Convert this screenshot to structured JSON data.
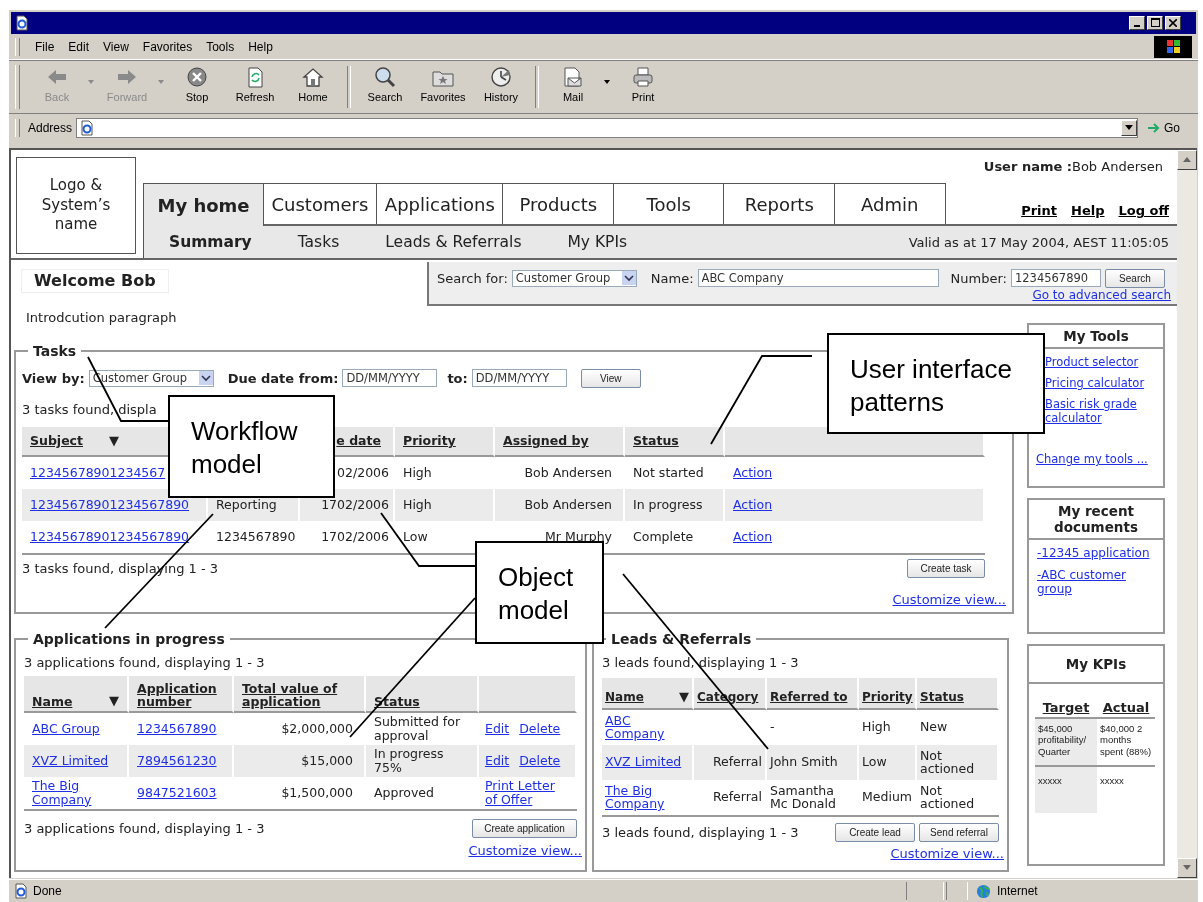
{
  "menu": [
    "File",
    "Edit",
    "View",
    "Favorites",
    "Tools",
    "Help"
  ],
  "toolbar": [
    {
      "kind": "back",
      "label": "Back",
      "disabled": true,
      "has_menu": true
    },
    {
      "kind": "forward",
      "label": "Forward",
      "disabled": true,
      "has_menu": true
    },
    {
      "kind": "stop",
      "label": "Stop",
      "disabled": false,
      "has_menu": false
    },
    {
      "kind": "refresh",
      "label": "Refresh",
      "disabled": false,
      "has_menu": false
    },
    {
      "kind": "home",
      "label": "Home",
      "disabled": false,
      "has_menu": false
    },
    {
      "kind": "separator"
    },
    {
      "kind": "search",
      "label": "Search",
      "disabled": false,
      "has_menu": false
    },
    {
      "kind": "favorites",
      "label": "Favorites",
      "disabled": false,
      "has_menu": false
    },
    {
      "kind": "history",
      "label": "History",
      "disabled": false,
      "has_menu": false
    },
    {
      "kind": "separator"
    },
    {
      "kind": "mail",
      "label": "Mail",
      "disabled": false,
      "has_menu": true
    },
    {
      "kind": "print",
      "label": "Print",
      "disabled": false,
      "has_menu": false
    }
  ],
  "address": {
    "label": "Address",
    "go": "Go"
  },
  "logo": "Logo & System’s name",
  "user_name": "**User name :**Bob Andersen",
  "header_links": [
    "Print",
    "Help",
    "Log off"
  ],
  "tabs": [
    {
      "label": "My home",
      "selected": true
    },
    {
      "label": "Customers",
      "selected": false
    },
    {
      "label": "Applications",
      "selected": false
    },
    {
      "label": "Products",
      "selected": false
    },
    {
      "label": "Tools",
      "selected": false
    },
    {
      "label": "Reports",
      "selected": false
    },
    {
      "label": "Admin",
      "selected": false
    }
  ],
  "subtabs": [
    {
      "label": "Summary",
      "selected": true
    },
    {
      "label": "Tasks",
      "selected": false
    },
    {
      "label": "Leads & Referrals",
      "selected": false
    },
    {
      "label": "My KPIs",
      "selected": false
    }
  ],
  "valid_as_at": "Valid as at 17 May 2004, AEST 11:05:05",
  "welcome": "Welcome Bob",
  "search": {
    "search_for_label": "Search for:",
    "search_for_value": "Customer Group",
    "name_label": "Name:",
    "name_value": "ABC Company",
    "number_label": "Number:",
    "number_value": "1234567890",
    "button": "Search",
    "advanced_link": "Go to advanced search"
  },
  "intro": "Introdcution paragraph",
  "tasks": {
    "title": "Tasks",
    "view_by_label": "View by:",
    "view_by_value": "Customer Group",
    "due_label": "Due date  from:",
    "from_placeholder": "DD/MM/YYYY",
    "to_label": "to:",
    "to_placeholder": "DD/MM/YYYY",
    "view_button": "View",
    "summary_top": "3 tasks found, displa",
    "columns": {
      "subject": {
        "label": "Subject",
        "sort_mark": "▼"
      },
      "due": {
        "label": "e date"
      },
      "priority": {
        "label": "Priority"
      },
      "assigned_by": {
        "label": "Assigned by"
      },
      "status": {
        "label": "Status"
      }
    },
    "rows": [
      {
        "subject": "12345678901234567",
        "due": "02/2006",
        "priority": "High",
        "assigned_by": "Bob Andersen",
        "status": "Not started",
        "action": "Action"
      },
      {
        "subject": "12345678901234567890",
        "type": "Reporting",
        "due": "1702/2006",
        "priority": "High",
        "assigned_by": "Bob Andersen",
        "status": "In progress",
        "action": "Action"
      },
      {
        "subject": "12345678901234567890",
        "type": "1234567890",
        "due": "1702/2006",
        "priority": "Low",
        "assigned_by": "Mr Murphy",
        "status": "Complete",
        "action": "Action"
      }
    ],
    "summary_bottom": "3 tasks found, displaying 1 - 3",
    "create_button": "Create task",
    "customize_link": "Customize view..."
  },
  "applications": {
    "title": "Applications in progress",
    "summary_top": "3 applications found, displaying 1 - 3",
    "columns": [
      {
        "label": "Name",
        "sort_mark": "▼"
      },
      {
        "label": "Application number"
      },
      {
        "label": "Total value of application"
      },
      {
        "label": "Status"
      }
    ],
    "rows": [
      {
        "name": "ABC Group",
        "number": "1234567890",
        "value": "$2,000,000",
        "status": "Submitted for approval",
        "actions": [
          "Edit",
          "Delete"
        ]
      },
      {
        "name": "XVZ Limited",
        "number": "7894561230",
        "value": "$15,000",
        "status": "In progress 75%",
        "actions": [
          "Edit",
          "Delete"
        ]
      },
      {
        "name": "The Big Company",
        "number": "9847521603",
        "value": "$1,500,000",
        "status": "Approved",
        "actions": [
          "Print Letter of Offer"
        ]
      }
    ],
    "summary_bottom": "3 applications found, displaying 1 - 3",
    "create_button": "Create application",
    "customize_link": "Customize view..."
  },
  "leads": {
    "title": "Leads & Referrals",
    "summary_top": "3 leads found, displaying 1 - 3",
    "columns": [
      {
        "label": "Name",
        "sort_mark": "▼"
      },
      {
        "label": "Category"
      },
      {
        "label": "Referred to"
      },
      {
        "label": "Priority"
      },
      {
        "label": "Status"
      }
    ],
    "rows": [
      {
        "name": "ABC Company",
        "referred_to": "-",
        "priority": "High",
        "status": "New"
      },
      {
        "name": "XVZ Limited",
        "category": "Referral",
        "referred_to": "John Smith",
        "priority": "Low",
        "status": "Not actioned"
      },
      {
        "name": "The Big Company",
        "category": "Referral",
        "referred_to": "Samantha Mc Donald",
        "priority": "Medium",
        "status": "Not actioned"
      }
    ],
    "summary_bottom": "3 leads found, displaying 1 - 3",
    "buttons": [
      "Create lead",
      "Send referral"
    ],
    "customize_link": "Customize view..."
  },
  "my_tools": {
    "title": "My Tools",
    "links": [
      "Product selector",
      "Pricing calculator",
      "Basic risk grade calculator"
    ],
    "change_link": "Change my tools ..."
  },
  "recent_documents": {
    "title": "My recent documents",
    "links": [
      "-12345 application",
      "-ABC customer group"
    ]
  },
  "kpis": {
    "title": "My KPIs",
    "columns": [
      "Target",
      "Actual"
    ],
    "rows": [
      [
        "$45,000 profitability/ Quarter",
        "$40,000 2 months spent (88%)"
      ],
      [
        "xxxxx",
        "xxxxx"
      ]
    ]
  },
  "callouts": [
    {
      "text": "Workflow model"
    },
    {
      "text": "User interface patterns"
    },
    {
      "text": "Object model"
    }
  ],
  "status_bar": {
    "text": "Done",
    "zone": "Internet"
  }
}
